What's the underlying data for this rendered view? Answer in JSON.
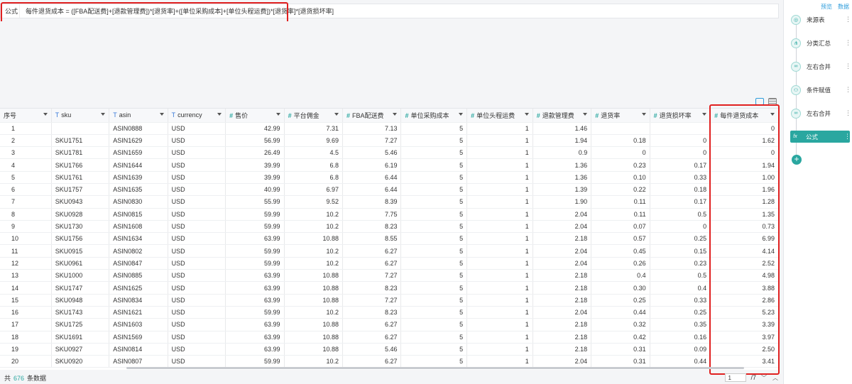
{
  "formula": {
    "label": "公式",
    "expression": "每件退货成本 = ([FBA配送费]+[退款管理费])*[退货率]+([单位采购成本]+[单位头程运费])*[退货率]*[退货损坏率]"
  },
  "table": {
    "columns": [
      {
        "type": "",
        "label": "序号"
      },
      {
        "type": "T",
        "label": "sku"
      },
      {
        "type": "T",
        "label": "asin"
      },
      {
        "type": "T",
        "label": "currency"
      },
      {
        "type": "#",
        "label": "售价"
      },
      {
        "type": "#",
        "label": "平台佣金"
      },
      {
        "type": "#",
        "label": "FBA配送费"
      },
      {
        "type": "#",
        "label": "单位采购成本"
      },
      {
        "type": "#",
        "label": "单位头程运费"
      },
      {
        "type": "#",
        "label": "退款管理费"
      },
      {
        "type": "#",
        "label": "退货率"
      },
      {
        "type": "#",
        "label": "退货损坏率"
      },
      {
        "type": "#",
        "label": "每件退货成本"
      }
    ],
    "rows": [
      [
        "1",
        "",
        "ASIN0888",
        "USD",
        "42.99",
        "7.31",
        "7.13",
        "5",
        "1",
        "1.46",
        "",
        "",
        "0"
      ],
      [
        "2",
        "SKU1751",
        "ASIN1629",
        "USD",
        "56.99",
        "9.69",
        "7.27",
        "5",
        "1",
        "1.94",
        "0.18",
        "0",
        "1.62"
      ],
      [
        "3",
        "SKU1781",
        "ASIN1659",
        "USD",
        "26.49",
        "4.5",
        "5.46",
        "5",
        "1",
        "0.9",
        "0",
        "0",
        "0"
      ],
      [
        "4",
        "SKU1766",
        "ASIN1644",
        "USD",
        "39.99",
        "6.8",
        "6.19",
        "5",
        "1",
        "1.36",
        "0.23",
        "0.17",
        "1.94"
      ],
      [
        "5",
        "SKU1761",
        "ASIN1639",
        "USD",
        "39.99",
        "6.8",
        "6.44",
        "5",
        "1",
        "1.36",
        "0.10",
        "0.33",
        "1.00"
      ],
      [
        "6",
        "SKU1757",
        "ASIN1635",
        "USD",
        "40.99",
        "6.97",
        "6.44",
        "5",
        "1",
        "1.39",
        "0.22",
        "0.18",
        "1.96"
      ],
      [
        "7",
        "SKU0943",
        "ASIN0830",
        "USD",
        "55.99",
        "9.52",
        "8.39",
        "5",
        "1",
        "1.90",
        "0.11",
        "0.17",
        "1.28"
      ],
      [
        "8",
        "SKU0928",
        "ASIN0815",
        "USD",
        "59.99",
        "10.2",
        "7.75",
        "5",
        "1",
        "2.04",
        "0.11",
        "0.5",
        "1.35"
      ],
      [
        "9",
        "SKU1730",
        "ASIN1608",
        "USD",
        "59.99",
        "10.2",
        "8.23",
        "5",
        "1",
        "2.04",
        "0.07",
        "0",
        "0.73"
      ],
      [
        "10",
        "SKU1756",
        "ASIN1634",
        "USD",
        "63.99",
        "10.88",
        "8.55",
        "5",
        "1",
        "2.18",
        "0.57",
        "0.25",
        "6.99"
      ],
      [
        "11",
        "SKU0915",
        "ASIN0802",
        "USD",
        "59.99",
        "10.2",
        "6.27",
        "5",
        "1",
        "2.04",
        "0.45",
        "0.15",
        "4.14"
      ],
      [
        "12",
        "SKU0961",
        "ASIN0847",
        "USD",
        "59.99",
        "10.2",
        "6.27",
        "5",
        "1",
        "2.04",
        "0.26",
        "0.23",
        "2.52"
      ],
      [
        "13",
        "SKU1000",
        "ASIN0885",
        "USD",
        "63.99",
        "10.88",
        "7.27",
        "5",
        "1",
        "2.18",
        "0.4",
        "0.5",
        "4.98"
      ],
      [
        "14",
        "SKU1747",
        "ASIN1625",
        "USD",
        "63.99",
        "10.88",
        "8.23",
        "5",
        "1",
        "2.18",
        "0.30",
        "0.4",
        "3.88"
      ],
      [
        "15",
        "SKU0948",
        "ASIN0834",
        "USD",
        "63.99",
        "10.88",
        "7.27",
        "5",
        "1",
        "2.18",
        "0.25",
        "0.33",
        "2.86"
      ],
      [
        "16",
        "SKU1743",
        "ASIN1621",
        "USD",
        "59.99",
        "10.2",
        "8.23",
        "5",
        "1",
        "2.04",
        "0.44",
        "0.25",
        "5.23"
      ],
      [
        "17",
        "SKU1725",
        "ASIN1603",
        "USD",
        "63.99",
        "10.88",
        "6.27",
        "5",
        "1",
        "2.18",
        "0.32",
        "0.35",
        "3.39"
      ],
      [
        "18",
        "SKU1691",
        "ASIN1569",
        "USD",
        "63.99",
        "10.88",
        "6.27",
        "5",
        "1",
        "2.18",
        "0.42",
        "0.16",
        "3.97"
      ],
      [
        "19",
        "SKU0927",
        "ASIN0814",
        "USD",
        "63.99",
        "10.88",
        "5.46",
        "5",
        "1",
        "2.18",
        "0.31",
        "0.09",
        "2.50"
      ],
      [
        "20",
        "SKU0920",
        "ASIN0807",
        "USD",
        "59.99",
        "10.2",
        "6.27",
        "5",
        "1",
        "2.04",
        "0.31",
        "0.44",
        "3.41"
      ]
    ]
  },
  "footer": {
    "prefix": "共",
    "count": "676",
    "suffix": "条数据",
    "page": "1",
    "page_total": "/7"
  },
  "sidebar": {
    "preview": "预览",
    "data": "数据",
    "steps": [
      {
        "icon": "source-table-icon",
        "glyph": "◎",
        "label": "来源表",
        "active": false
      },
      {
        "icon": "group-summary-icon",
        "glyph": "⋔",
        "label": "分类汇总",
        "active": false
      },
      {
        "icon": "merge-icon",
        "glyph": "∞",
        "label": "左右合并",
        "active": false
      },
      {
        "icon": "conditional-assign-icon",
        "glyph": "⚇",
        "label": "条件赋值",
        "active": false
      },
      {
        "icon": "merge-icon",
        "glyph": "∞",
        "label": "左右合并",
        "active": false
      },
      {
        "icon": "formula-icon",
        "glyph": "fx",
        "label": "公式",
        "active": true
      }
    ]
  }
}
